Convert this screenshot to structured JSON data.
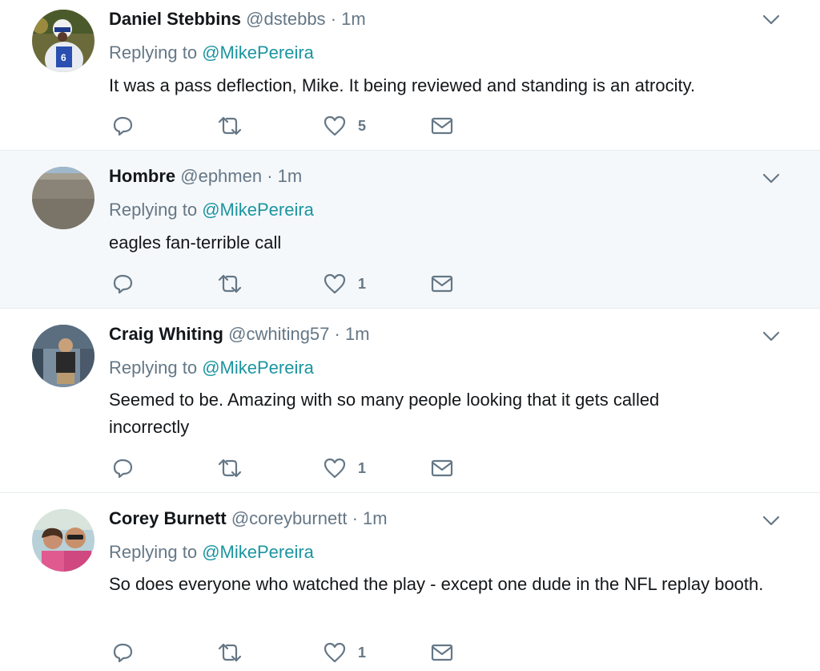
{
  "replying_prefix": "Replying to",
  "tweets": [
    {
      "name": "Daniel Stebbins",
      "handle": "@dstebbs",
      "time": "· 1m",
      "replying_to": "@MikePereira",
      "text": "It was a pass deflection, Mike. It being reviewed and standing is an atrocity.",
      "likes": "5",
      "highlighted": false,
      "avatar_icon": "football-player-photo"
    },
    {
      "name": "Hombre",
      "handle": "@ephmen",
      "time": "· 1m",
      "replying_to": "@MikePereira",
      "text": "eagles fan-terrible call",
      "likes": "1",
      "highlighted": true,
      "avatar_icon": "desert-landscape-photo"
    },
    {
      "name": "Craig Whiting",
      "handle": "@cwhiting57",
      "time": "· 1m",
      "replying_to": "@MikePereira",
      "text": "Seemed to be. Amazing with so many people looking that it gets called incorrectly",
      "likes": "1",
      "highlighted": false,
      "avatar_icon": "man-standing-photo"
    },
    {
      "name": "Corey Burnett",
      "handle": "@coreyburnett",
      "time": "· 1m",
      "replying_to": "@MikePereira",
      "text": "So does everyone who watched the play - except one dude in the NFL replay booth.",
      "likes": "1",
      "highlighted": false,
      "avatar_icon": "couple-selfie-photo"
    }
  ],
  "colors": {
    "mention": "#1b95a0",
    "secondary_text": "#657786",
    "highlight_bg": "#f5f8fa"
  }
}
